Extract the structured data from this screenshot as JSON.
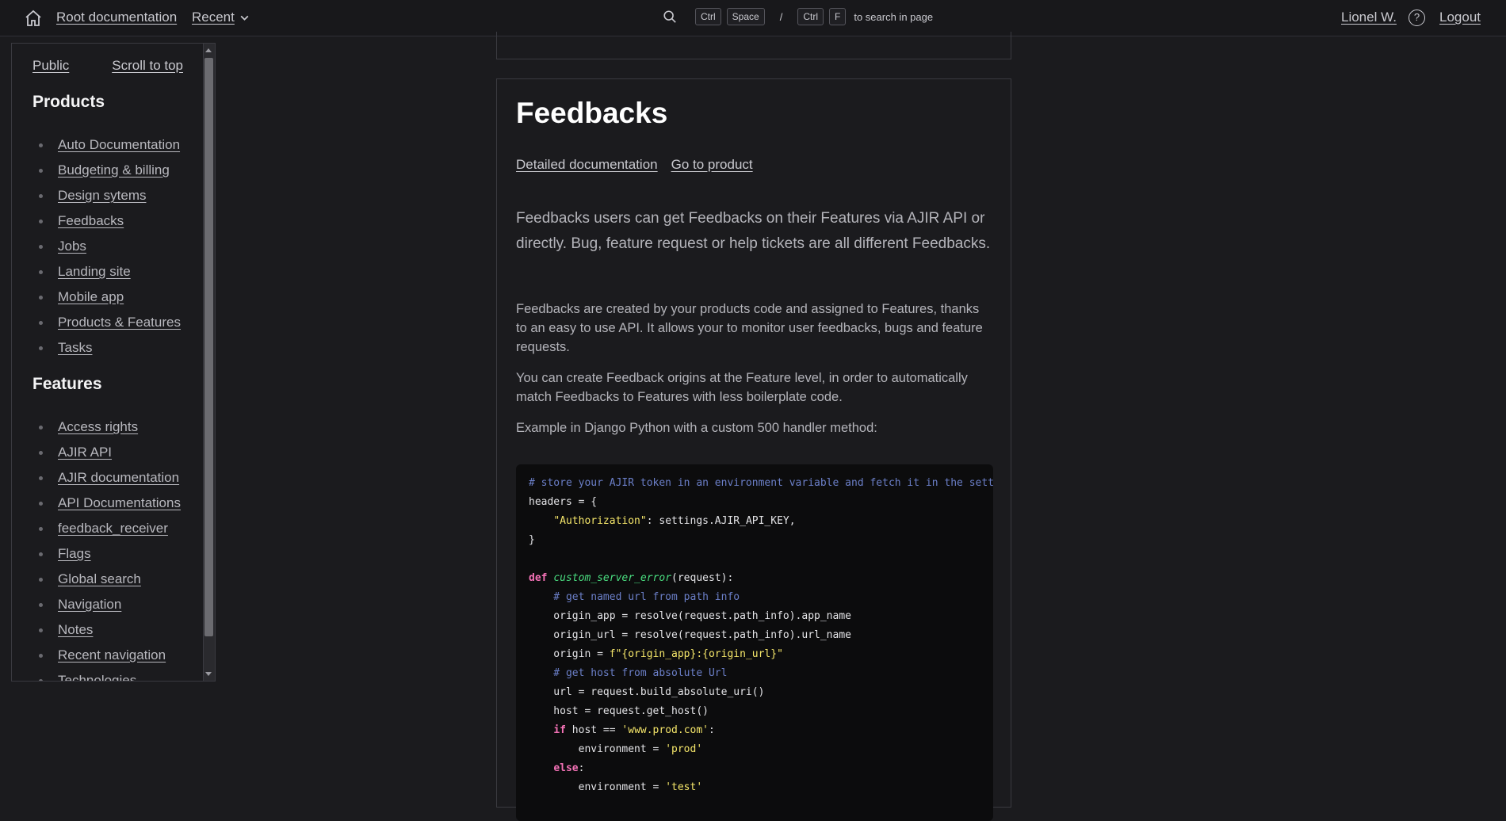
{
  "topbar": {
    "home_icon": "home-icon",
    "root_link": "Root documentation",
    "recent": "Recent",
    "search_keys_1": [
      "Ctrl",
      "Space"
    ],
    "slash": "/",
    "search_keys_2": [
      "Ctrl",
      "F"
    ],
    "search_hint": "to search in page",
    "user": "Lionel W.",
    "help": "?",
    "logout": "Logout"
  },
  "sidebar": {
    "public": "Public",
    "scroll_to_top": "Scroll to top",
    "products_title": "Products",
    "products": [
      "Auto Documentation",
      "Budgeting & billing",
      "Design sytems",
      "Feedbacks",
      "Jobs",
      "Landing site",
      "Mobile app",
      "Products & Features",
      "Tasks"
    ],
    "features_title": "Features",
    "features": [
      "Access rights",
      "AJIR API",
      "AJIR documentation",
      "API Documentations",
      "feedback_receiver",
      "Flags",
      "Global search",
      "Navigation",
      "Notes",
      "Recent navigation",
      "Technologies"
    ]
  },
  "main": {
    "title": "Feedbacks",
    "link_detailed": "Detailed documentation",
    "link_product": "Go to product",
    "lead": "Feedbacks users can get Feedbacks on their Features via AJIR API or directly. Bug, feature request or help tickets are all different Feedbacks.",
    "para1": "Feedbacks are created by your products code and assigned to Features, thanks to an easy to use API. It allows your to monitor user feedbacks, bugs and feature requests.",
    "para2": "You can create Feedback origins at the Feature level, in order to automatically match Feedbacks to Features with less boilerplate code.",
    "para3": "Example in Django Python with a custom 500 handler method:",
    "code_lines": [
      "# store your AJIR token in an environment variable and fetch it in the settings",
      "headers = {",
      "    \"Authorization\": settings.AJIR_API_KEY,",
      "}",
      "",
      "def custom_server_error(request):",
      "    # get named url from path info",
      "    origin_app = resolve(request.path_info).app_name",
      "    origin_url = resolve(request.path_info).url_name",
      "    origin = f\"{origin_app}:{origin_url}\"",
      "    # get host from absolute Url",
      "    url = request.build_absolute_uri()",
      "    host = request.get_host()",
      "    if host == 'www.prod.com':",
      "        environment = 'prod'",
      "    else:",
      "        environment = 'test'"
    ]
  }
}
